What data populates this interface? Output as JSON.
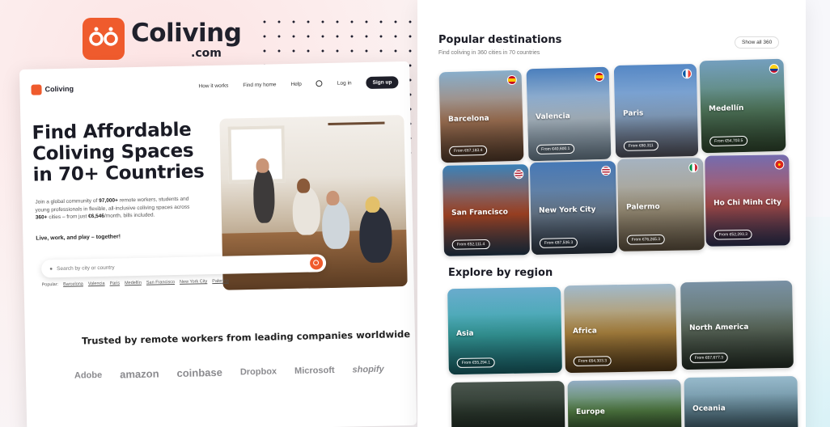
{
  "brand": {
    "name": "Coliving",
    "tld": ".com"
  },
  "nav": {
    "logo": "Coliving",
    "links": [
      "How it works",
      "Find my home",
      "Help"
    ],
    "globe_icon": "globe-icon",
    "login": "Log in",
    "signup": "Sign up"
  },
  "hero": {
    "title": "Find Affordable Coliving Spaces in 70+ Countries",
    "sub_pre": "Join a global community of ",
    "sub_count": "97,000+",
    "sub_mid": " remote workers, students and young professionals in flexible, all-inclusive coliving spaces across ",
    "sub_cities": "360+",
    "sub_mid2": " cities – from just ",
    "sub_price": "€6,546",
    "sub_post": "/month, bills included.",
    "tagline": "Live, work, and play – together!"
  },
  "search": {
    "placeholder": "Search by city or country",
    "popular_label": "Popular:",
    "popular": [
      "Barcelona",
      "Valencia",
      "Paris",
      "Medellín",
      "San Francisco",
      "New York City",
      "Palermo"
    ]
  },
  "trusted": {
    "title": "Trusted by remote workers from leading companies worldwide",
    "logos": [
      "Adobe",
      "amazon",
      "coinbase",
      "Dropbox",
      "Microsoft",
      "shopify"
    ]
  },
  "destinations": {
    "title": "Popular destinations",
    "subtitle": "Find coliving in 360 cities in 70 countries",
    "show_all": "Show all 360",
    "cities": [
      {
        "name": "Barcelona",
        "price": "From €67,183.4",
        "flag": "spain",
        "colors": [
          "#8fb7d6",
          "#b98461",
          "#6a4a35"
        ]
      },
      {
        "name": "Valencia",
        "price": "From €40,600.1",
        "flag": "spain",
        "colors": [
          "#4f86c7",
          "#c9d9e6",
          "#8aa3b7"
        ]
      },
      {
        "name": "Paris",
        "price": "From €80,311",
        "flag": "france",
        "colors": [
          "#5a8fd0",
          "#9fc0e6",
          "#6a6a78"
        ]
      },
      {
        "name": "Medellín",
        "price": "From €54,703.5",
        "flag": "colombia",
        "colors": [
          "#7aa7c8",
          "#5d8a6a",
          "#3d5a3a"
        ]
      },
      {
        "name": "San Francisco",
        "price": "From €52,111.4",
        "flag": "usa",
        "colors": [
          "#3d88c2",
          "#c2502a",
          "#2e4b67"
        ]
      },
      {
        "name": "New York City",
        "price": "From €87,536.3",
        "flag": "usa",
        "colors": [
          "#4a7fc0",
          "#7a8ea4",
          "#384556"
        ]
      },
      {
        "name": "Palermo",
        "price": "From €76,265.3",
        "flag": "italy",
        "colors": [
          "#aebccb",
          "#b6a98e",
          "#7b6a53"
        ]
      },
      {
        "name": "Ho Chi Minh City",
        "price": "From €52,293.3",
        "flag": "vietnam",
        "colors": [
          "#7b72b8",
          "#c45a5a",
          "#3b3f6b"
        ]
      }
    ]
  },
  "regions": {
    "title": "Explore by region",
    "items": [
      {
        "name": "Asia",
        "price": "From €55,294.1",
        "colors": [
          "#6fb4d8",
          "#3db3b3",
          "#1f7b84"
        ]
      },
      {
        "name": "Africa",
        "price": "From €64,303.3",
        "colors": [
          "#a9c3d6",
          "#c99a4a",
          "#6b4a20"
        ]
      },
      {
        "name": "North America",
        "price": "From €67,677.3",
        "colors": [
          "#7f98ad",
          "#6a7a6a",
          "#2f3b30"
        ]
      },
      {
        "name": "",
        "price": "",
        "colors": [
          "#4e5a52",
          "#2e3b30",
          "#1f2a22"
        ]
      },
      {
        "name": "Europe",
        "price": "",
        "colors": [
          "#9bb6cf",
          "#5a8a4a",
          "#2f4b2a"
        ]
      },
      {
        "name": "Oceania",
        "price": "",
        "colors": [
          "#9fc3d6",
          "#6f95a6",
          "#40606e"
        ]
      }
    ]
  }
}
